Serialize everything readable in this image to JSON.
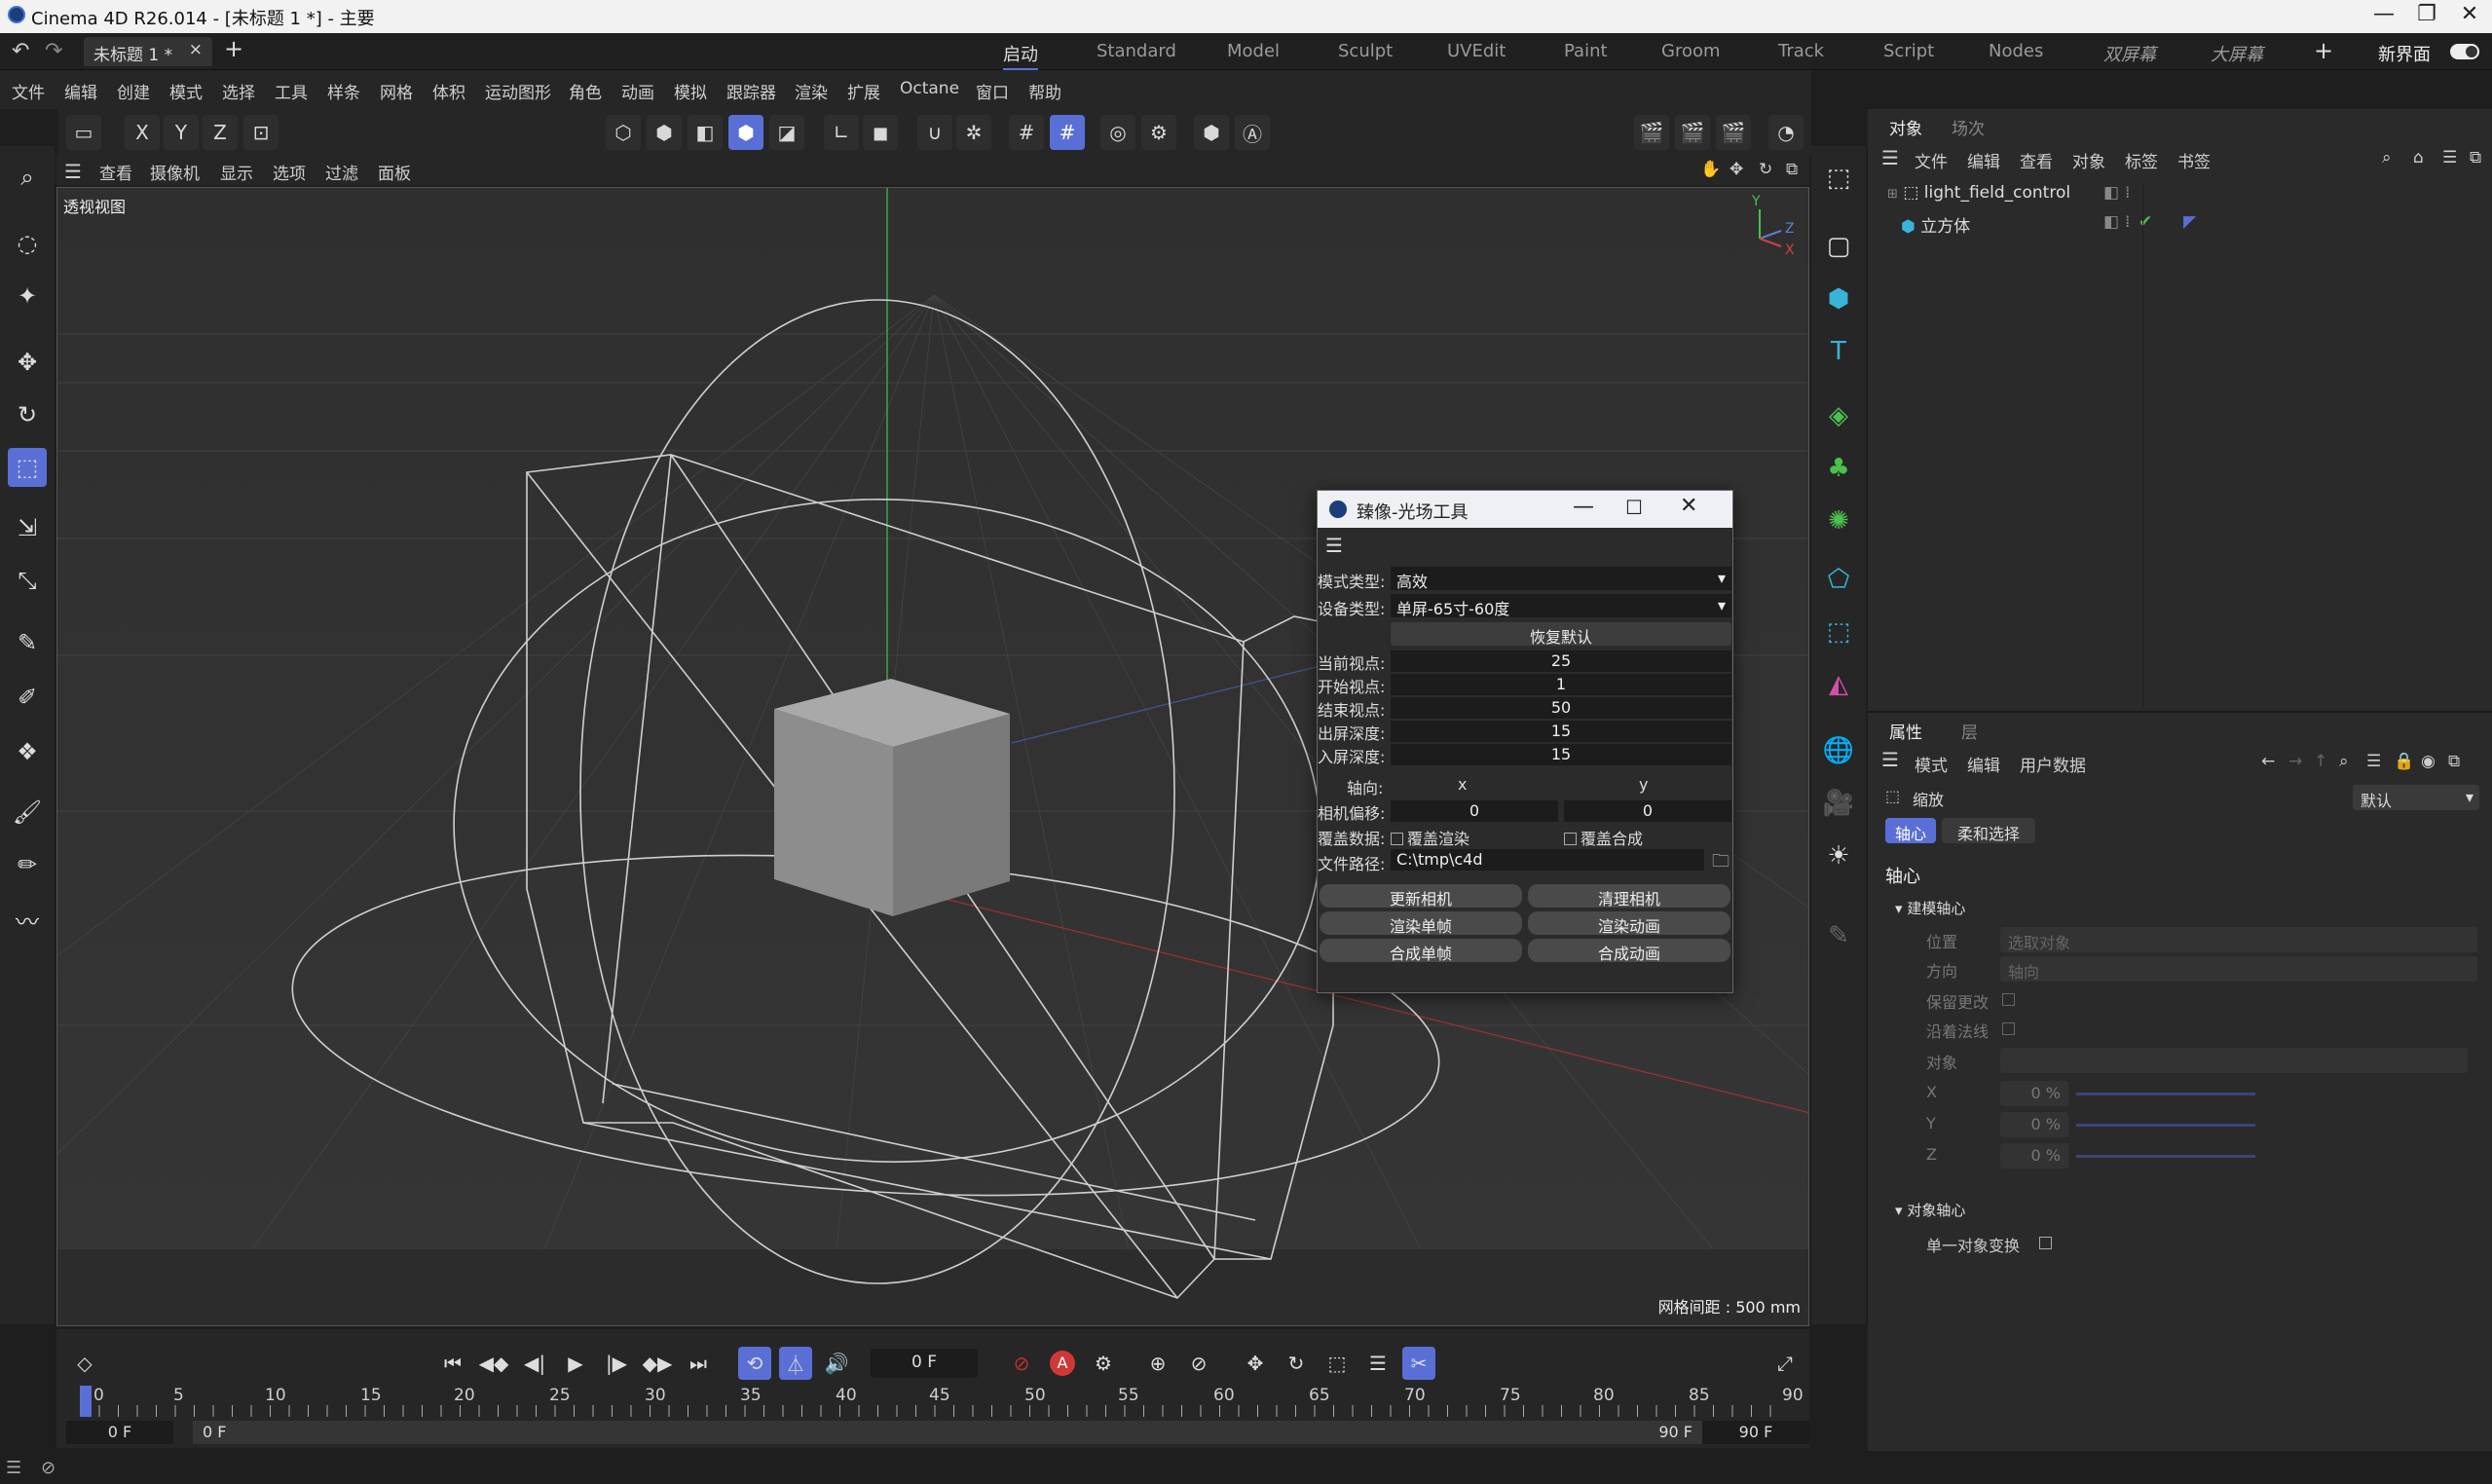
{
  "window": {
    "title": "Cinema 4D R26.014 - [未标题 1 *] - 主要",
    "minimize": "—",
    "restore": "❐",
    "close": "✕"
  },
  "tabs": {
    "doc_tab": "未标题 1 *",
    "doc_close": "×",
    "add": "+",
    "workspaces": [
      "启动",
      "Standard",
      "Model",
      "Sculpt",
      "UVEdit",
      "Paint",
      "Groom",
      "Track",
      "Script",
      "Nodes",
      "双屏幕",
      "大屏幕"
    ],
    "new_layout": "新界面",
    "plus": "+"
  },
  "menu": [
    "文件",
    "编辑",
    "创建",
    "模式",
    "选择",
    "工具",
    "样条",
    "网格",
    "体积",
    "运动图形",
    "角色",
    "动画",
    "模拟",
    "跟踪器",
    "渲染",
    "扩展",
    "Octane",
    "窗口",
    "帮助"
  ],
  "toolbar": {
    "x": "X",
    "y": "Y",
    "z": "Z"
  },
  "viewport": {
    "menu": [
      "查看",
      "摄像机",
      "显示",
      "选项",
      "过滤",
      "面板"
    ],
    "label": "透视视图",
    "grid_spacing": "网格间距 : 500 mm",
    "axis_y": "Y",
    "axis_z": "Z",
    "axis_x": "X"
  },
  "dialog": {
    "title": "臻像-光场工具",
    "mode_label": "模式类型:",
    "mode_value": "高效",
    "device_label": "设备类型:",
    "device_value": "单屏-65寸-60度",
    "reset": "恢复默认",
    "fields": [
      {
        "label": "当前视点:",
        "value": "25"
      },
      {
        "label": "开始视点:",
        "value": "1"
      },
      {
        "label": "结束视点:",
        "value": "50"
      },
      {
        "label": "出屏深度:",
        "value": "15"
      },
      {
        "label": "入屏深度:",
        "value": "15"
      }
    ],
    "axis_label": "轴向:",
    "axis_x": "x",
    "axis_y": "y",
    "offset_label": "相机偏移:",
    "offset_x": "0",
    "offset_y": "0",
    "cover_label": "覆盖数据:",
    "cover_render": "覆盖渲染",
    "cover_compose": "覆盖合成",
    "path_label": "文件路径:",
    "path_value": "C:\\tmp\\c4d",
    "buttons": [
      "更新相机",
      "清理相机",
      "渲染单帧",
      "渲染动画",
      "合成单帧",
      "合成动画"
    ]
  },
  "objects_panel": {
    "tabs": [
      "对象",
      "场次"
    ],
    "menu": [
      "文件",
      "编辑",
      "查看",
      "对象",
      "标签",
      "书签"
    ],
    "items": [
      "light_field_control",
      "立方体"
    ]
  },
  "attributes": {
    "tabs": [
      "属性",
      "层"
    ],
    "menu": [
      "模式",
      "编辑",
      "用户数据"
    ],
    "tool": "缩放",
    "preset": "默认",
    "subtabs": [
      "轴心",
      "柔和选择"
    ],
    "section": "轴心",
    "group1": "建模轴心",
    "rows": [
      {
        "label": "位置",
        "value": "选取对象"
      },
      {
        "label": "方向",
        "value": "轴向"
      }
    ],
    "keep_changes": "保留更改",
    "along_normal": "沿着法线",
    "object": "对象",
    "xyz": [
      {
        "label": "X",
        "value": "0 %"
      },
      {
        "label": "Y",
        "value": "0 %"
      },
      {
        "label": "Z",
        "value": "0 %"
      }
    ],
    "group2": "对象轴心",
    "single_transform": "单一对象变换"
  },
  "timeline": {
    "current_frame": "0 F",
    "ticks": [
      "0",
      "5",
      "10",
      "15",
      "20",
      "25",
      "30",
      "35",
      "40",
      "45",
      "50",
      "55",
      "60",
      "65",
      "70",
      "75",
      "80",
      "85",
      "90"
    ],
    "start": "0 F",
    "range_start": "0 F",
    "range_end": "90 F",
    "end": "90 F"
  },
  "colors": {
    "accent": "#5a6fd6",
    "green": "#4cc04c",
    "cyan": "#38b4d8",
    "pink": "#d44fa8"
  }
}
